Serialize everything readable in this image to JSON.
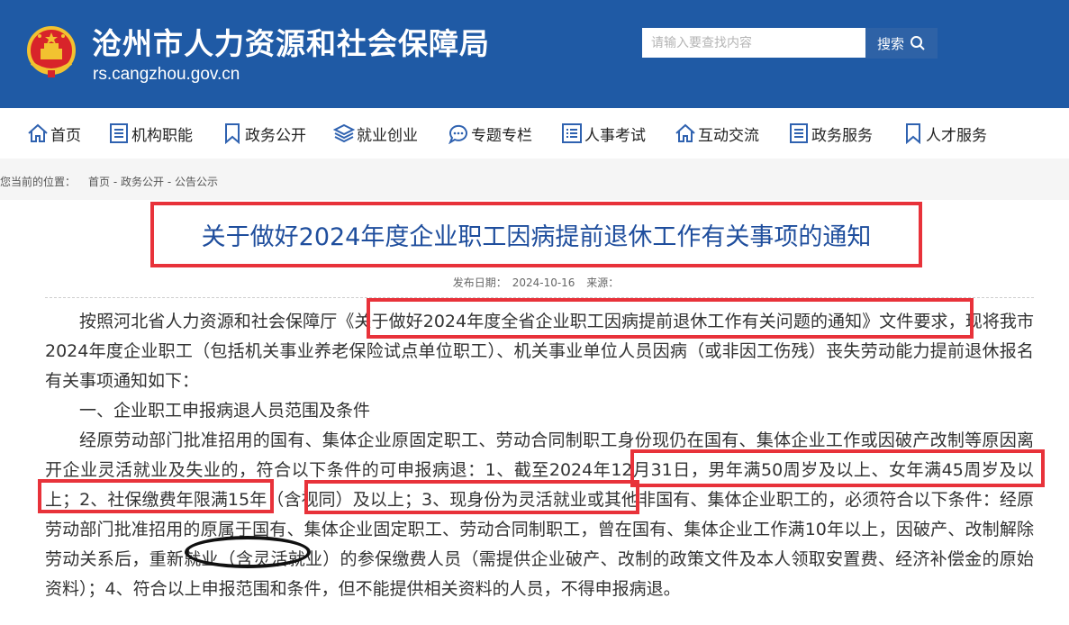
{
  "header": {
    "site_title": "沧州市人力资源和社会保障局",
    "site_domain": "rs.cangzhou.gov.cn",
    "emblem_icon": "national-emblem-icon",
    "search_placeholder": "请输入要查找内容",
    "search_button": "搜索",
    "search_icon": "search-icon"
  },
  "nav": {
    "items": [
      {
        "label": "首页",
        "icon": "home-icon"
      },
      {
        "label": "机构职能",
        "icon": "list-icon"
      },
      {
        "label": "政务公开",
        "icon": "bookmark-icon"
      },
      {
        "label": "就业创业",
        "icon": "layers-icon"
      },
      {
        "label": "专题专栏",
        "icon": "chat-icon"
      },
      {
        "label": "人事考试",
        "icon": "checklist-icon"
      },
      {
        "label": "互动交流",
        "icon": "home-icon"
      },
      {
        "label": "政务服务",
        "icon": "list-icon"
      },
      {
        "label": "人才服务",
        "icon": "bookmark-icon"
      }
    ]
  },
  "breadcrumb": {
    "prefix": "您当前的位置：",
    "items": [
      "首页",
      "政务公开",
      "公告公示"
    ],
    "separator": "-"
  },
  "article": {
    "title": "关于做好2024年度企业职工因病提前退休工作有关事项的通知",
    "date_label": "发布日期：",
    "date": "2024-10-16",
    "source_label": "来源：",
    "paragraphs": [
      "按照河北省人力资源和社会保障厅《关于做好2024年度全省企业职工因病提前退休工作有关问题的通知》文件要求，现将我市2024年度企业职工（包括机关事业养老保险试点单位职工）、机关事业单位人员因病（或非因工伤残）丧失劳动能力提前退休报名有关事项通知如下：",
      "一、企业职工申报病退人员范围及条件",
      "经原劳动部门批准招用的国有、集体企业原固定职工、劳动合同制职工身份现仍在国有、集体企业工作或因破产改制等原因离开企业灵活就业及失业的，符合以下条件的可申报病退：1、截至2024年12月31日，男年满50周岁及以上、女年满45周岁及以上；2、社保缴费年限满15年（含视同）及以上；3、现身份为灵活就业或其他非国有、集体企业职工的，必须符合以下条件：经原劳动部门批准招用的原属于国有、集体企业固定职工、劳动合同制职工，曾在国有、集体企业工作满10年以上，因破产、改制解除劳动关系后，重新就业（含灵活就业）的参保缴费人员（需提供企业破产、改制的政策文件及本人领取安置费、经济补偿金的原始资料）；4、符合以上申报范围和条件，但不能提供相关资料的人员，不得申报病退。"
    ]
  },
  "colors": {
    "header_bg": "#1f5aa5",
    "search_button_bg": "#2e62a6",
    "title_text": "#1f4e9d",
    "annotation_red": "#e8323a",
    "annotation_black": "#111111"
  }
}
